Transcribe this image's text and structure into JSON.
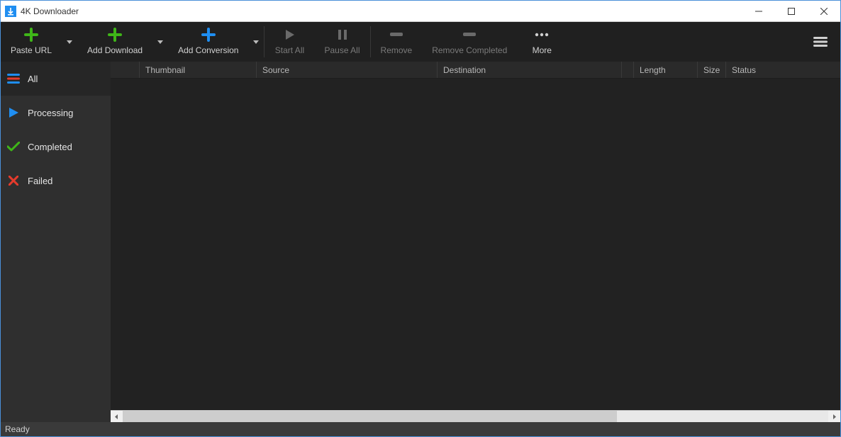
{
  "window": {
    "title": "4K Downloader"
  },
  "toolbar": {
    "paste_url": "Paste URL",
    "add_download": "Add Download",
    "add_conversion": "Add Conversion",
    "start_all": "Start All",
    "pause_all": "Pause All",
    "remove": "Remove",
    "remove_completed": "Remove Completed",
    "more": "More"
  },
  "sidebar": {
    "all": "All",
    "processing": "Processing",
    "completed": "Completed",
    "failed": "Failed"
  },
  "columns": {
    "blank": "",
    "thumbnail": "Thumbnail",
    "source": "Source",
    "destination": "Destination",
    "dest2": "",
    "length": "Length",
    "size": "Size",
    "status": "Status"
  },
  "status": {
    "text": "Ready"
  },
  "colors": {
    "green": "#3fb618",
    "blue": "#1f8ef1",
    "red": "#e43b2c",
    "disabled": "#7a7a7a"
  }
}
